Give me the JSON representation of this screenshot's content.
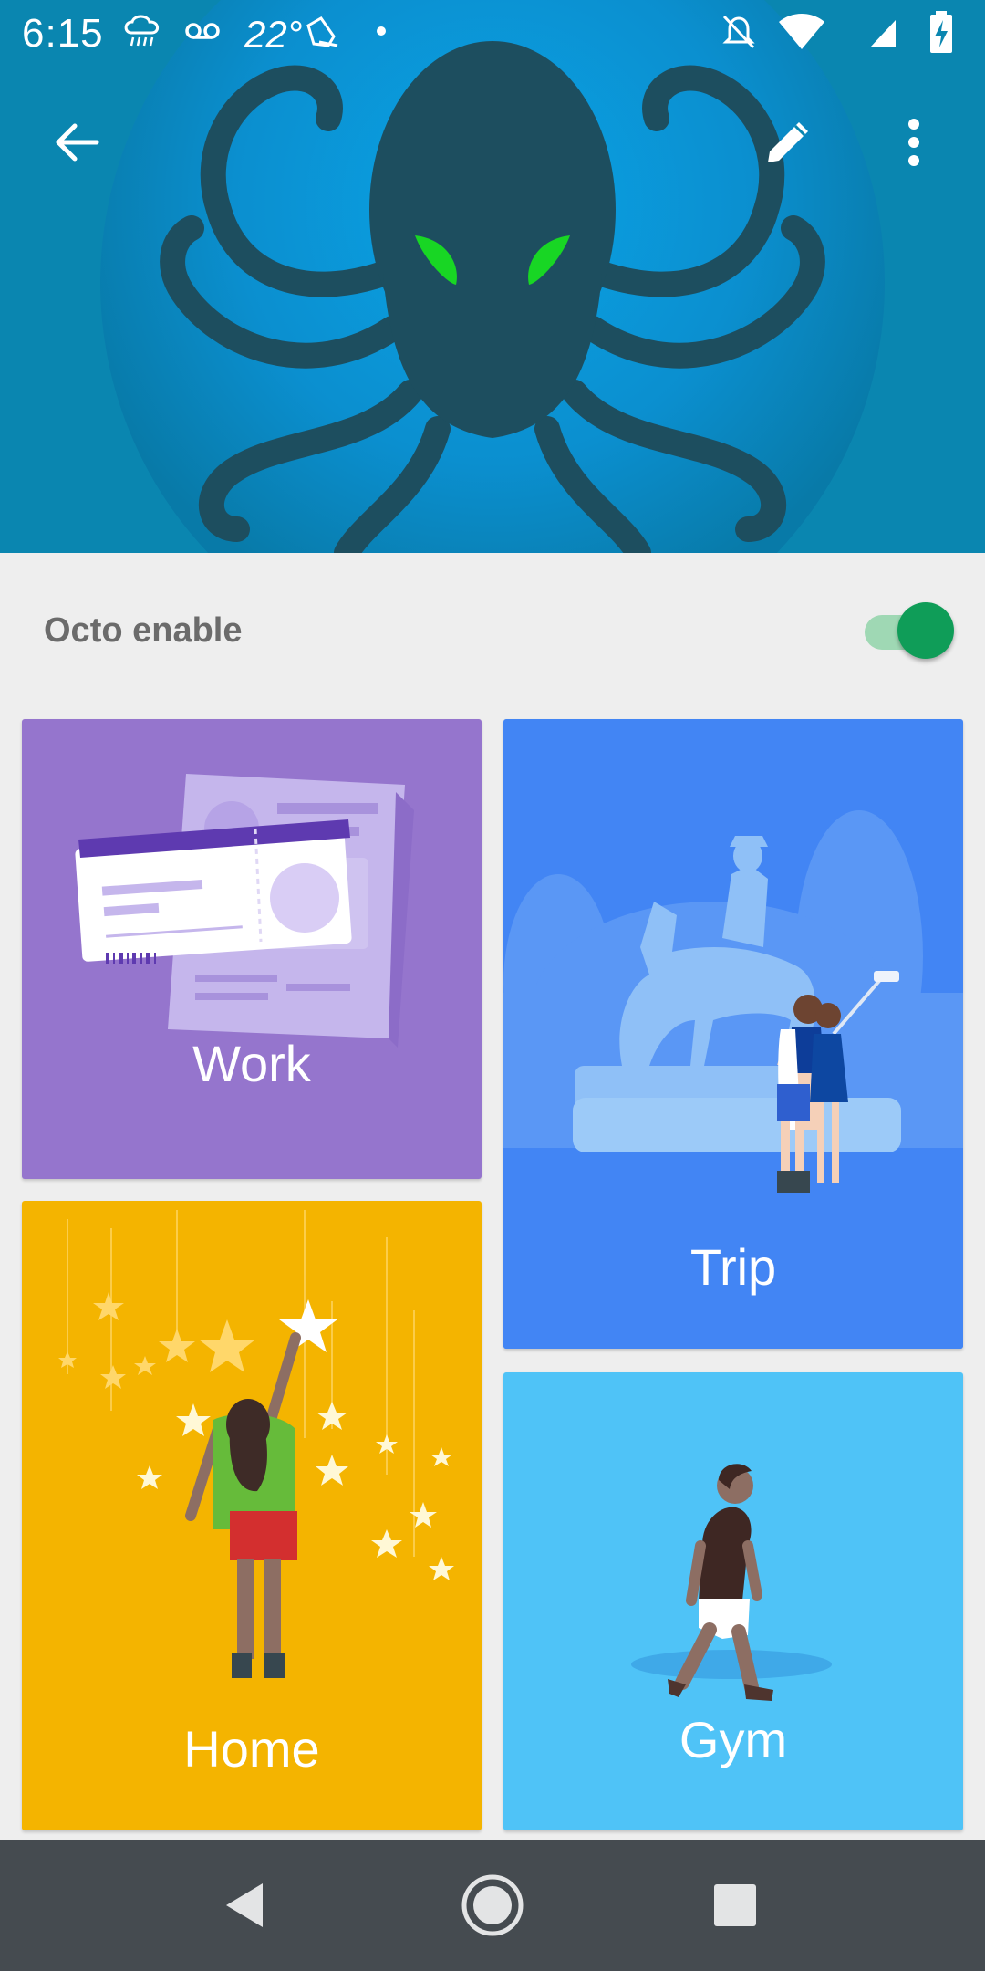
{
  "status_bar": {
    "time": "6:15",
    "temperature": "22°",
    "icons": [
      "weather-rain-icon",
      "voicemail-icon",
      "notification-icon",
      "dot-icon",
      "notifications-off-icon",
      "wifi-icon",
      "signal-icon",
      "battery-charging-icon"
    ]
  },
  "toolbar": {
    "back_icon": "arrow-back-icon",
    "edit_icon": "pencil-icon",
    "more_icon": "more-vert-icon"
  },
  "settings": {
    "toggle_label": "Octo enable",
    "toggle_on": true
  },
  "cards": {
    "work": {
      "label": "Work",
      "color": "#9575cd"
    },
    "trip": {
      "label": "Trip",
      "color": "#4285f4"
    },
    "home": {
      "label": "Home",
      "color": "#f4b400"
    },
    "gym": {
      "label": "Gym",
      "color": "#4fc3f7"
    }
  },
  "navbar": {
    "back": "nav-back-icon",
    "home": "nav-home-icon",
    "recents": "nav-recents-icon"
  }
}
